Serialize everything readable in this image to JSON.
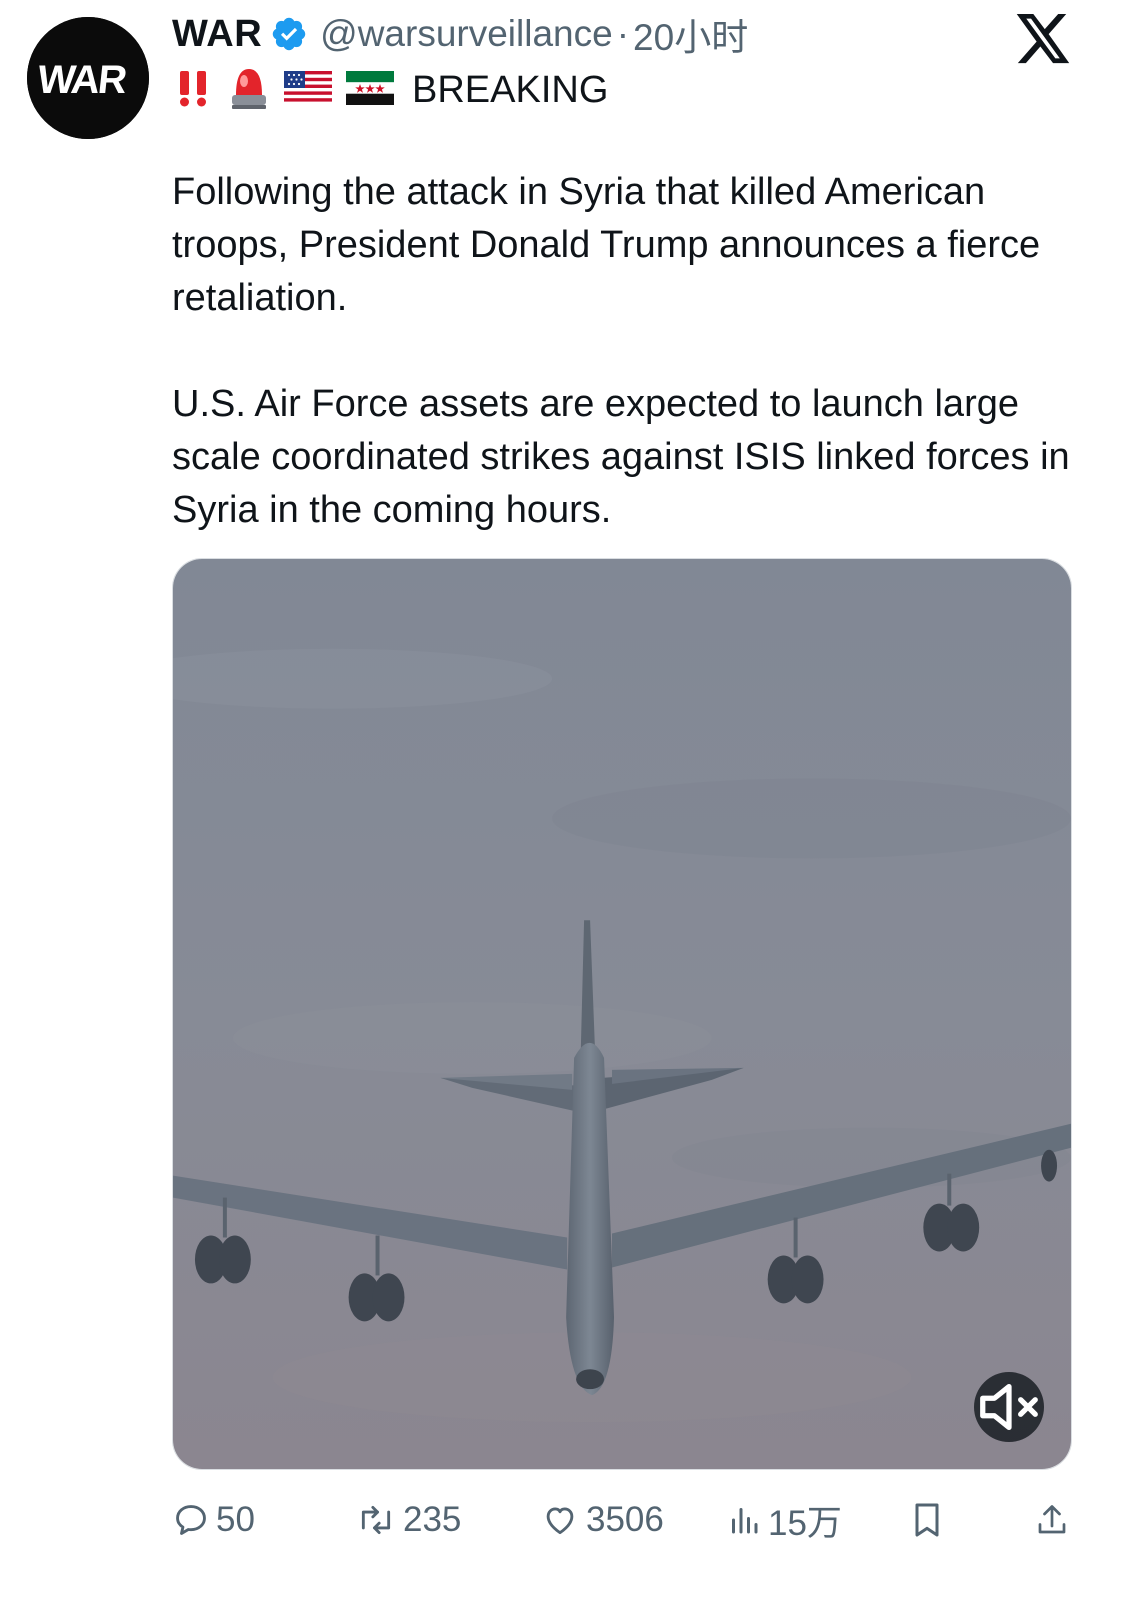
{
  "tweet": {
    "author": {
      "display_name": "WAR",
      "avatar_text": "WAR",
      "verified": true,
      "handle": "@warsurveillance",
      "separator": "·",
      "time": "20小时"
    },
    "header_line": {
      "emojis": [
        "double-exclamation",
        "police-light",
        "us-flag",
        "syria-flag"
      ],
      "label": "BREAKING"
    },
    "body": {
      "paragraph_1": "Following the attack in Syria that killed American troops, President Donald Trump announces a fierce retaliation.",
      "paragraph_2": "U.S. Air Force assets are expected to launch large scale coordinated strikes against ISIS linked forces in Syria in the coming hours."
    },
    "media": {
      "type": "video",
      "muted": true
    },
    "metrics": {
      "replies": "50",
      "reposts": "235",
      "likes": "3506",
      "views": "15万"
    }
  },
  "icons": {
    "platform": "x-logo",
    "verified": "verified-badge-icon",
    "reply": "reply-icon",
    "repost": "repost-icon",
    "like": "heart-icon",
    "views": "views-icon",
    "bookmark": "bookmark-icon",
    "share": "share-icon",
    "mute": "muted-speaker-icon"
  },
  "colors": {
    "text_primary": "#0f1419",
    "text_secondary": "#536471",
    "verified_blue": "#1d9bf0",
    "sky": "#858a95"
  }
}
